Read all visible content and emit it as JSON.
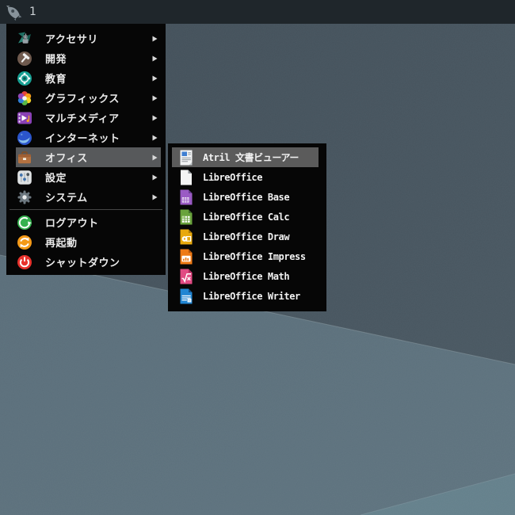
{
  "taskbar": {
    "launcher_icon": "rocket-icon",
    "workspace_label": "1"
  },
  "menu": {
    "categories": [
      {
        "id": "accessories",
        "label": "アクセサリ",
        "icon": "accessories-icon",
        "has_submenu": true,
        "selected": false
      },
      {
        "id": "development",
        "label": "開発",
        "icon": "development-hammer-icon",
        "has_submenu": true,
        "selected": false
      },
      {
        "id": "education",
        "label": "教育",
        "icon": "education-icon",
        "has_submenu": true,
        "selected": false
      },
      {
        "id": "graphics",
        "label": "グラフィックス",
        "icon": "graphics-icon",
        "has_submenu": true,
        "selected": false
      },
      {
        "id": "multimedia",
        "label": "マルチメディア",
        "icon": "multimedia-icon",
        "has_submenu": true,
        "selected": false
      },
      {
        "id": "internet",
        "label": "インターネット",
        "icon": "internet-icon",
        "has_submenu": true,
        "selected": false
      },
      {
        "id": "office",
        "label": "オフィス",
        "icon": "office-briefcase-icon",
        "has_submenu": true,
        "selected": true
      },
      {
        "id": "settings",
        "label": "設定",
        "icon": "settings-icon",
        "has_submenu": true,
        "selected": false
      },
      {
        "id": "system",
        "label": "システム",
        "icon": "system-gear-icon",
        "has_submenu": true,
        "selected": false
      }
    ],
    "session_items": [
      {
        "id": "logout",
        "label": "ログアウト",
        "icon": "logout-icon",
        "has_submenu": false,
        "selected": false
      },
      {
        "id": "restart",
        "label": "再起動",
        "icon": "restart-icon",
        "has_submenu": false,
        "selected": false
      },
      {
        "id": "shutdown",
        "label": "シャットダウン",
        "icon": "shutdown-icon",
        "has_submenu": false,
        "selected": false
      }
    ]
  },
  "submenu": {
    "items": [
      {
        "id": "atril",
        "label": "Atril 文書ビューアー",
        "icon": "atril-document-viewer-icon",
        "selected": true
      },
      {
        "id": "libreoffice",
        "label": "LibreOffice",
        "icon": "libreoffice-icon",
        "selected": false
      },
      {
        "id": "libreoffice-base",
        "label": "LibreOffice Base",
        "icon": "libreoffice-base-icon",
        "selected": false
      },
      {
        "id": "libreoffice-calc",
        "label": "LibreOffice Calc",
        "icon": "libreoffice-calc-icon",
        "selected": false
      },
      {
        "id": "libreoffice-draw",
        "label": "LibreOffice Draw",
        "icon": "libreoffice-draw-icon",
        "selected": false
      },
      {
        "id": "libreoffice-impress",
        "label": "LibreOffice Impress",
        "icon": "libreoffice-impress-icon",
        "selected": false
      },
      {
        "id": "libreoffice-math",
        "label": "LibreOffice Math",
        "icon": "libreoffice-math-icon",
        "selected": false
      },
      {
        "id": "libreoffice-writer",
        "label": "LibreOffice Writer",
        "icon": "libreoffice-writer-icon",
        "selected": false
      }
    ]
  },
  "colors": {
    "taskbar_bg": "#1f262b",
    "menu_bg": "#060606",
    "menu_text": "#e9e9e9",
    "menu_highlight": "#57595b",
    "submenu_highlight": "#5b5b5b",
    "wallpaper_top": "#46545e",
    "wallpaper_bottom": "#5b6f7b",
    "wallpaper_corner": "#64808b"
  }
}
